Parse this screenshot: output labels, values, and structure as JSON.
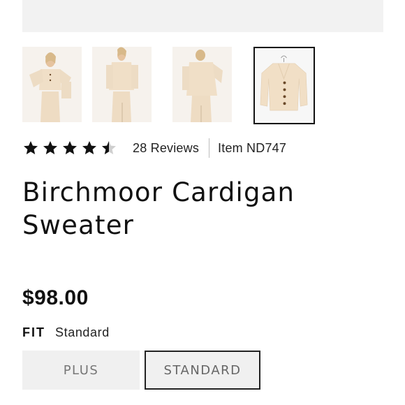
{
  "gallery": {
    "thumbnails": [
      {
        "alt": "model-front-view",
        "selected": false
      },
      {
        "alt": "model-side-view",
        "selected": false
      },
      {
        "alt": "model-back-view",
        "selected": false
      },
      {
        "alt": "product-flat-view",
        "selected": true
      }
    ]
  },
  "rating": {
    "stars": 4.5,
    "reviews_label": "28 Reviews",
    "item_label": "Item ND747"
  },
  "product": {
    "title_line1": "Birchmoor Cardigan",
    "title_line2": "Sweater",
    "price": "$98.00"
  },
  "fit": {
    "label": "FIT",
    "value": "Standard",
    "options": [
      "PLUS",
      "STANDARD"
    ],
    "selected": "STANDARD"
  },
  "colors": {
    "sweater": "#f1dfc6",
    "text": "#111111"
  }
}
